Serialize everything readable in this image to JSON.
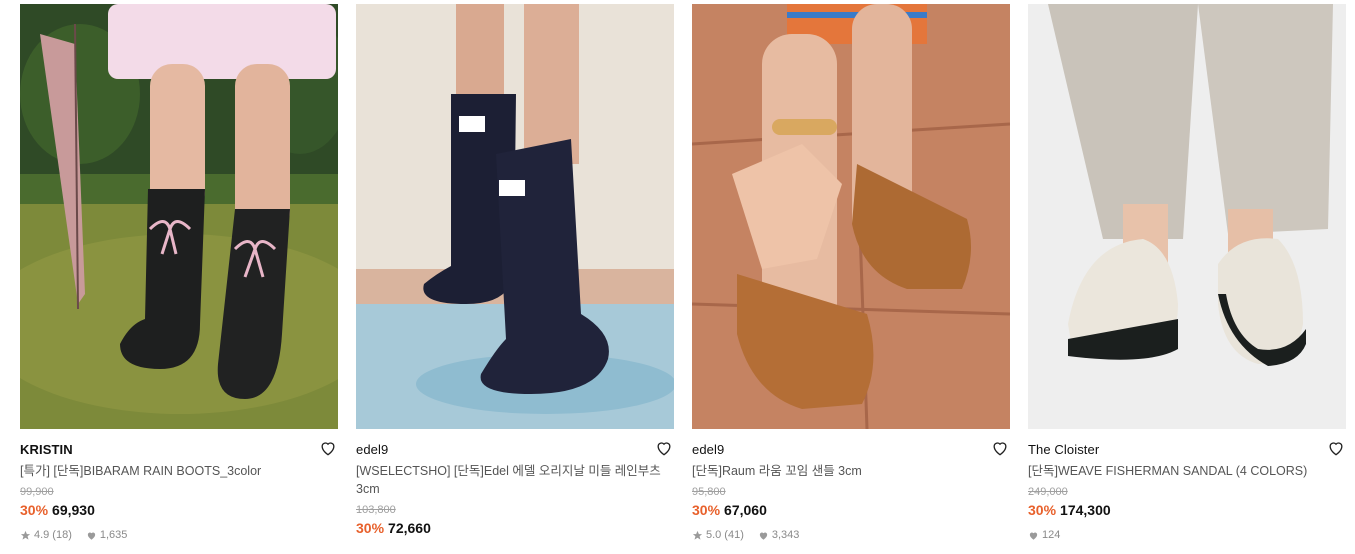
{
  "products": [
    {
      "brand": "KRISTIN",
      "name": "[특가] [단독]BIBARAM RAIN BOOTS_3color",
      "original_price": "99,900",
      "discount": "30%",
      "price": "69,930",
      "rating": "4.9",
      "reviews": "(18)",
      "likes": "1,635",
      "image": "black rain boots with pink bow on grass"
    },
    {
      "brand": "edel9",
      "name": "[WSELECTSHO] [단독]Edel 에델 오리지날 미들 레인부츠 3cm",
      "original_price": "103,800",
      "discount": "30%",
      "price": "72,660",
      "image": "navy mid rain boots in water"
    },
    {
      "brand": "edel9",
      "name": "[단독]Raum 라움 꼬임 샌들 3cm",
      "original_price": "95,800",
      "discount": "30%",
      "price": "67,060",
      "rating": "5.0",
      "reviews": "(41)",
      "likes": "3,343",
      "image": "brown woven sandals on tile"
    },
    {
      "brand": "The Cloister",
      "name": "[단독]WEAVE FISHERMAN SANDAL (4 COLORS)",
      "original_price": "249,000",
      "discount": "30%",
      "price": "174,300",
      "likes": "124",
      "image": "white fisherman sandals"
    }
  ],
  "colors": {
    "discount": "#e8612c",
    "text": "#111111",
    "muted": "#8a8a8a"
  },
  "icons": [
    "heart-outline-icon",
    "star-icon",
    "heart-filled-icon"
  ]
}
